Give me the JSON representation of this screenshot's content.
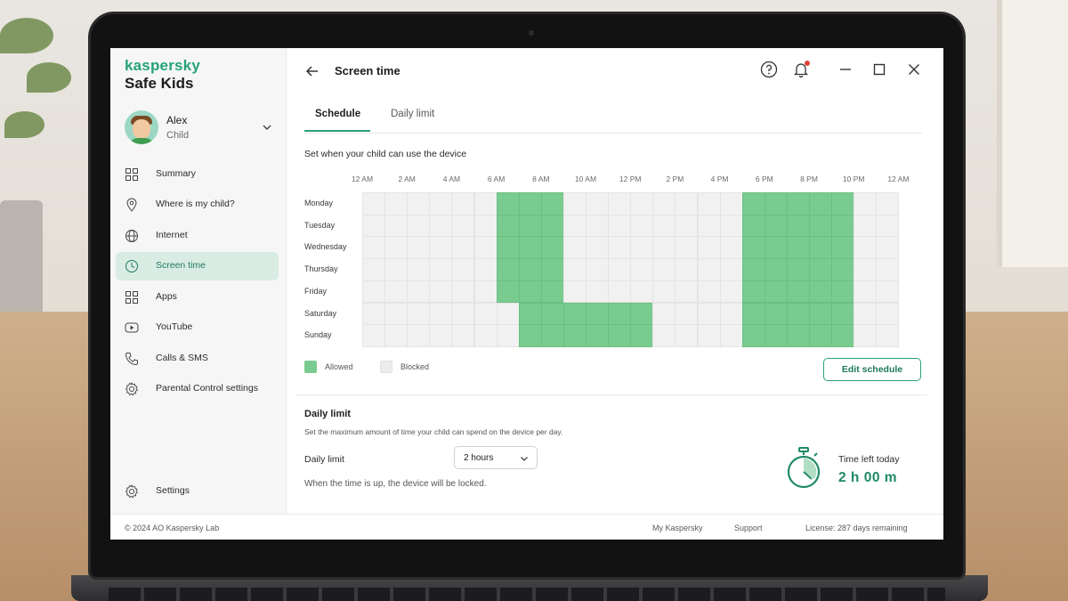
{
  "sidebar": {
    "brand": "kaspersky",
    "product": "Safe Kids",
    "child": {
      "name": "Alex",
      "role": "Child"
    },
    "items": [
      {
        "label": "Summary",
        "icon": "summary-icon"
      },
      {
        "label": "Where is my child?",
        "icon": "location-pin-icon"
      },
      {
        "label": "Internet",
        "icon": "globe-icon"
      },
      {
        "label": "Screen time",
        "icon": "clock-icon",
        "active": true
      },
      {
        "label": "Apps",
        "icon": "apps-grid-icon"
      },
      {
        "label": "YouTube",
        "icon": "youtube-icon"
      },
      {
        "label": "Calls & SMS",
        "icon": "phone-icon"
      },
      {
        "label": "Parental Control settings",
        "icon": "gear-icon"
      }
    ],
    "settings_label": "Settings"
  },
  "header": {
    "title": "Screen time",
    "icons": [
      "back-arrow-icon",
      "help-icon",
      "bell-icon",
      "minimize-icon",
      "maximize-icon",
      "close-icon"
    ]
  },
  "tabs": [
    {
      "label": "Schedule",
      "active": true
    },
    {
      "label": "Daily limit",
      "active": false
    }
  ],
  "schedule": {
    "hint": "Set when your child can use the device",
    "time_labels": [
      "12 AM",
      "2 AM",
      "4 AM",
      "6 AM",
      "8 AM",
      "10 AM",
      "12 PM",
      "2 PM",
      "4 PM",
      "6 PM",
      "8 PM",
      "10 PM",
      "12 AM"
    ],
    "days": [
      {
        "name": "Monday",
        "allowed_ranges": [
          [
            6,
            9
          ],
          [
            17,
            22
          ]
        ]
      },
      {
        "name": "Tuesday",
        "allowed_ranges": [
          [
            6,
            9
          ],
          [
            17,
            22
          ]
        ]
      },
      {
        "name": "Wednesday",
        "allowed_ranges": [
          [
            6,
            9
          ],
          [
            17,
            22
          ]
        ]
      },
      {
        "name": "Thursday",
        "allowed_ranges": [
          [
            6,
            9
          ],
          [
            17,
            22
          ]
        ]
      },
      {
        "name": "Friday",
        "allowed_ranges": [
          [
            6,
            9
          ],
          [
            17,
            22
          ]
        ]
      },
      {
        "name": "Saturday",
        "allowed_ranges": [
          [
            7,
            13
          ],
          [
            17,
            22
          ]
        ]
      },
      {
        "name": "Sunday",
        "allowed_ranges": [
          [
            7,
            13
          ],
          [
            17,
            22
          ]
        ]
      }
    ],
    "legend": {
      "allowed": "Allowed",
      "blocked": "Blocked"
    },
    "colors": {
      "allowed": "#7acb8f",
      "blocked": "#f1f1f1"
    },
    "edit_button": "Edit schedule"
  },
  "daily_limit": {
    "title": "Daily limit",
    "description": "Set the maximum amount of time your child can spend on the device per day.",
    "field_label": "Daily limit",
    "selected": "2 hours",
    "note": "When the time is up, the device will be locked.",
    "time_left_label": "Time left today",
    "time_left_value": "2 h 00 m"
  },
  "footer": {
    "copyright": "© 2024 AO Kaspersky Lab",
    "links": [
      "My Kaspersky",
      "Support"
    ],
    "license": "License: 287 days remaining"
  },
  "accent": "#27a17b"
}
